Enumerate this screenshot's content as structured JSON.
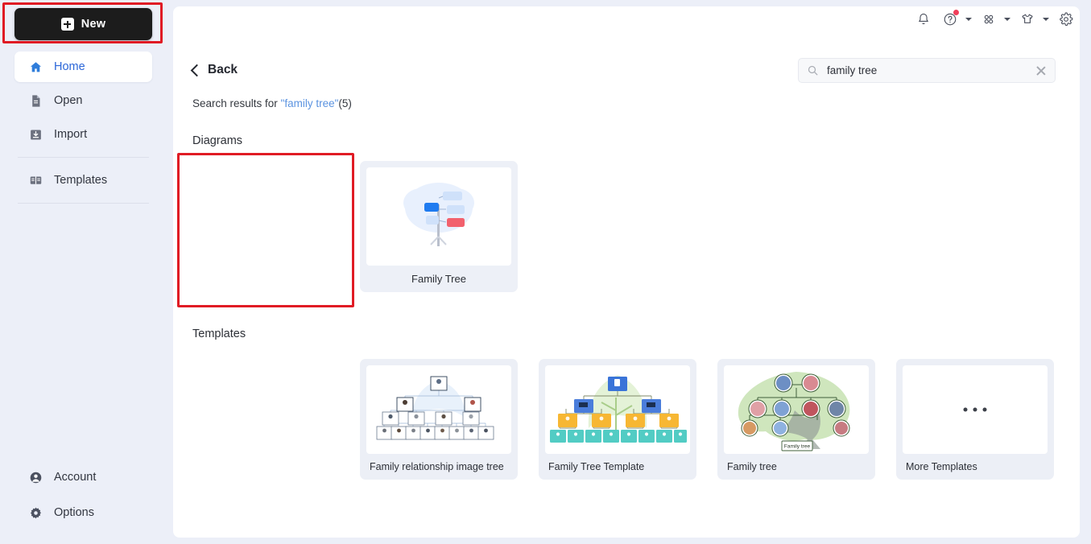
{
  "sidebar": {
    "new_button": {
      "label": "New",
      "icon": "plus-square-icon"
    },
    "items": [
      {
        "label": "Home",
        "icon": "home-icon",
        "active": true
      },
      {
        "label": "Open",
        "icon": "document-icon",
        "active": false
      },
      {
        "label": "Import",
        "icon": "import-icon",
        "active": false
      },
      {
        "label": "Templates",
        "icon": "templates-icon",
        "active": false
      }
    ],
    "bottom_items": [
      {
        "label": "Account",
        "icon": "account-icon"
      },
      {
        "label": "Options",
        "icon": "gear-icon"
      }
    ]
  },
  "topbar": {
    "icons": [
      {
        "name": "bell-icon",
        "has_chevron": false,
        "has_dot": false
      },
      {
        "name": "help-icon",
        "has_chevron": true,
        "has_dot": true
      },
      {
        "name": "apps-grid-icon",
        "has_chevron": true,
        "has_dot": false
      },
      {
        "name": "theme-shirt-icon",
        "has_chevron": true,
        "has_dot": false
      },
      {
        "name": "gear-icon",
        "has_chevron": false,
        "has_dot": false
      }
    ]
  },
  "content": {
    "back_label": "Back",
    "search": {
      "value": "family tree",
      "placeholder": "Search",
      "clear_icon": "close-icon",
      "search_icon": "search-icon"
    },
    "results": {
      "prefix": "Search results for ",
      "query": "\"family tree\"",
      "count": "(5)"
    },
    "sections": {
      "diagrams_title": "Diagrams",
      "templates_title": "Templates"
    },
    "diagrams": [
      {
        "label": "Family Tree",
        "thumb": "family-tree-outline"
      }
    ],
    "templates": [
      {
        "label": "Family relationship image tree",
        "thumb": "portrait-org-tree"
      },
      {
        "label": "Family Tree Template",
        "thumb": "color-org-tree"
      },
      {
        "label": "Family tree",
        "thumb": "avatar-green-tree"
      },
      {
        "label": "More Templates",
        "thumb": "ellipsis"
      }
    ]
  },
  "annotations": [
    {
      "name": "new-button-highlight",
      "color": "#e01b24"
    },
    {
      "name": "family-tree-card-highlight",
      "color": "#e01b24"
    }
  ],
  "colors": {
    "page_bg": "#eceff8",
    "panel_bg": "#ffffff",
    "accent_blue": "#2b66d8",
    "link_blue": "#5b93e0",
    "annotation_red": "#e01b24",
    "new_button_bg": "#1c1c1c"
  }
}
